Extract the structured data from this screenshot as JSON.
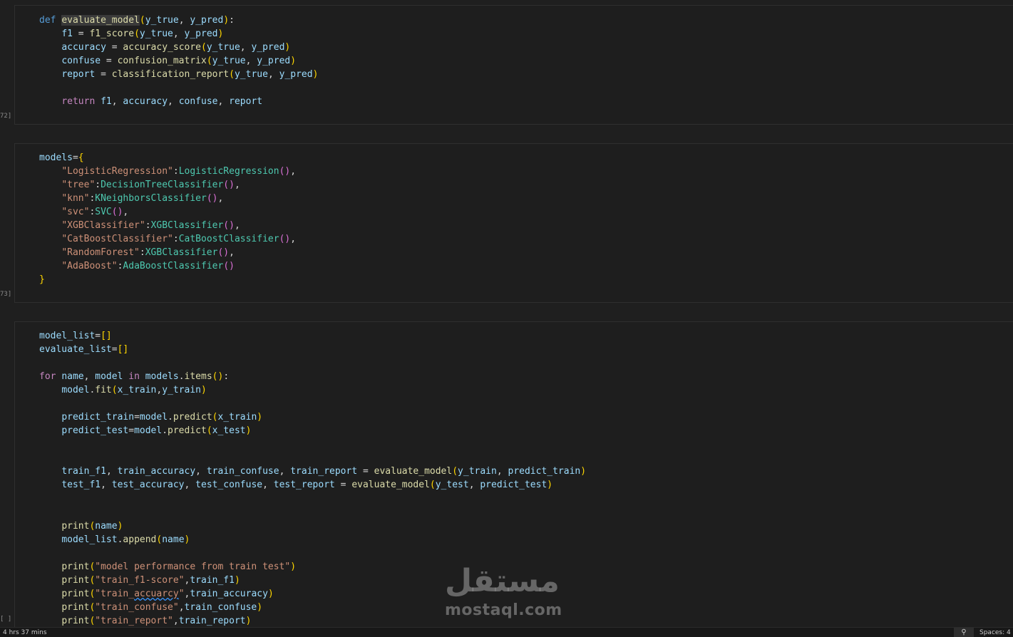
{
  "cells": [
    {
      "exec_label": "72]",
      "lines": [
        "def evaluate_model(y_true, y_pred):",
        "    f1 = f1_score(y_true, y_pred)",
        "    accuracy = accuracy_score(y_true, y_pred)",
        "    confuse = confusion_matrix(y_true, y_pred)",
        "    report = classification_report(y_true, y_pred)",
        "",
        "    return f1, accuracy, confuse, report"
      ]
    },
    {
      "exec_label": "73]",
      "lines": [
        "models={",
        "    \"LogisticRegression\":LogisticRegression(),",
        "    \"tree\":DecisionTreeClassifier(),",
        "    \"knn\":KNeighborsClassifier(),",
        "    \"svc\":SVC(),",
        "    \"XGBClassifier\":XGBClassifier(),",
        "    \"CatBoostClassifier\":CatBoostClassifier(),",
        "    \"RandomForest\":XGBClassifier(),",
        "    \"AdaBoost\":AdaBoostClassifier()",
        "}"
      ]
    },
    {
      "exec_label": "[ ]",
      "lines": [
        "model_list=[]",
        "evaluate_list=[]",
        "",
        "for name, model in models.items():",
        "    model.fit(x_train,y_train)",
        "",
        "    predict_train=model.predict(x_train)",
        "    predict_test=model.predict(x_test)",
        "",
        "",
        "    train_f1, train_accuracy, train_confuse, train_report = evaluate_model(y_train, predict_train)",
        "    test_f1, test_accuracy, test_confuse, test_report = evaluate_model(y_test, predict_test)",
        "",
        "",
        "    print(name)",
        "    model_list.append(name)",
        "",
        "    print(\"model performance from train test\")",
        "    print(\"train_f1-score\",train_f1)",
        "    print(\"train_accuarcy\",train_accuracy)",
        "    print(\"train_confuse\",train_confuse)",
        "    print(\"train_report\",train_report)"
      ]
    }
  ],
  "status_bar": {
    "left_text": "4 hrs 37 mins",
    "zoom_icon": "zoom-icon",
    "right_text": "Spaces: 4"
  },
  "watermark": {
    "arabic": "مستقل",
    "latin": "mostaql.com"
  },
  "colors": {
    "keyword": "#569cd6",
    "control": "#c586c0",
    "function": "#dcdcaa",
    "variable": "#9cdcfe",
    "string": "#ce9178",
    "class": "#4ec9b0",
    "bracket1": "#ffd700",
    "bracket2": "#da70d6"
  }
}
